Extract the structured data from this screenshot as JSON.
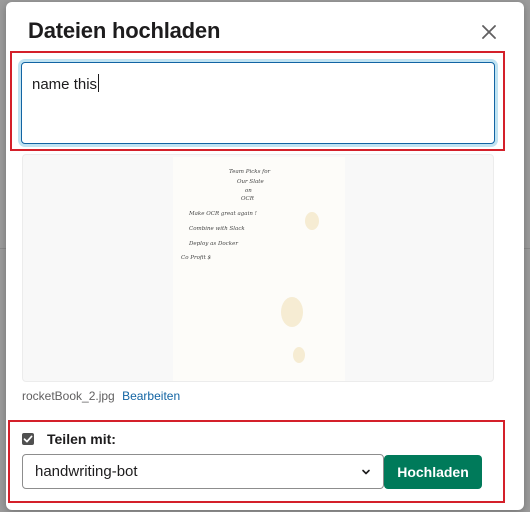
{
  "dialog": {
    "title": "Dateien hochladen",
    "close_icon": "close-icon"
  },
  "message": {
    "value": "name this"
  },
  "preview": {
    "handwriting_lines": [
      "Team Picks for",
      "Our Slate",
      "on",
      "OCR",
      "Make OCR great again !",
      "Combine with Slack",
      "Deploy as Docker",
      "Co Profit $"
    ]
  },
  "file": {
    "name": "rocketBook_2.jpg",
    "edit_label": "Bearbeiten"
  },
  "share": {
    "checked": true,
    "label": "Teilen mit:",
    "channel": "handwriting-bot",
    "chevron_icon": "chevron-down-icon"
  },
  "actions": {
    "upload_label": "Hochladen"
  },
  "colors": {
    "primary": "#007a5a",
    "link": "#1264a3",
    "focus": "#1264a3",
    "annotation": "#d4202a"
  }
}
